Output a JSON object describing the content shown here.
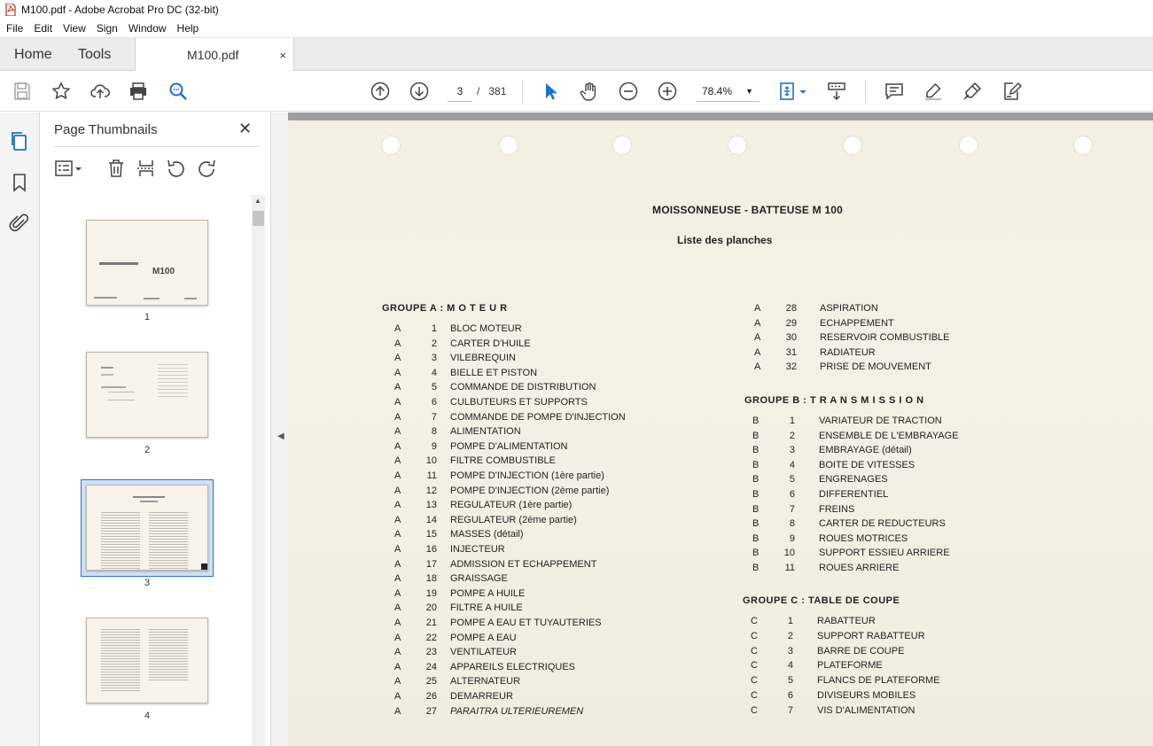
{
  "window": {
    "title": "M100.pdf - Adobe Acrobat Pro DC (32-bit)"
  },
  "menu": [
    "File",
    "Edit",
    "View",
    "Sign",
    "Window",
    "Help"
  ],
  "tabs": {
    "home": "Home",
    "tools": "Tools",
    "document": "M100.pdf",
    "close": "×"
  },
  "toolbar": {
    "page_current": "3",
    "page_separator": "/",
    "page_total": "381",
    "zoom": "78.4%"
  },
  "thumbnails": {
    "title": "Page Thumbnails",
    "pages": [
      {
        "label": "1",
        "text": "M100"
      },
      {
        "label": "2"
      },
      {
        "label": "3",
        "selected": true
      },
      {
        "label": "4"
      }
    ]
  },
  "document": {
    "title": "MOISSONNEUSE - BATTEUSE  M 100",
    "subtitle": "Liste des planches",
    "groups": {
      "a": "GROUPE  A  :  M O T E U R",
      "b": "GROUPE  B  :  T R A N S M I S S I O N",
      "c": "GROUPE  C  :  TABLE  DE  COUPE"
    },
    "col1": [
      [
        "A",
        "1",
        "BLOC MOTEUR"
      ],
      [
        "A",
        "2",
        "CARTER D'HUILE"
      ],
      [
        "A",
        "3",
        "VILEBREQUIN"
      ],
      [
        "A",
        "4",
        "BIELLE ET PISTON"
      ],
      [
        "A",
        "5",
        "COMMANDE DE DISTRIBUTION"
      ],
      [
        "A",
        "6",
        "CULBUTEURS ET SUPPORTS"
      ],
      [
        "A",
        "7",
        "COMMANDE DE POMPE D'INJECTION"
      ],
      [
        "A",
        "8",
        "ALIMENTATION"
      ],
      [
        "A",
        "9",
        "POMPE D'ALIMENTATION"
      ],
      [
        "A",
        "10",
        "FILTRE COMBUSTIBLE"
      ],
      [
        "A",
        "11",
        "POMPE D'INJECTION (1ère partie)"
      ],
      [
        "A",
        "12",
        "POMPE D'INJECTION (2ème partie)"
      ],
      [
        "A",
        "13",
        "REGULATEUR (1ère partie)"
      ],
      [
        "A",
        "14",
        "REGULATEUR (2ème partie)"
      ],
      [
        "A",
        "15",
        "MASSES (détail)"
      ],
      [
        "A",
        "16",
        "INJECTEUR"
      ],
      [
        "A",
        "17",
        "ADMISSION ET ECHAPPEMENT"
      ],
      [
        "A",
        "18",
        "GRAISSAGE"
      ],
      [
        "A",
        "19",
        "POMPE A HUILE"
      ],
      [
        "A",
        "20",
        "FILTRE A HUILE"
      ],
      [
        "A",
        "21",
        "POMPE A EAU ET TUYAUTERIES"
      ],
      [
        "A",
        "22",
        "POMPE A EAU"
      ],
      [
        "A",
        "23",
        "VENTILATEUR"
      ],
      [
        "A",
        "24",
        "APPAREILS ELECTRIQUES"
      ],
      [
        "A",
        "25",
        "ALTERNATEUR"
      ],
      [
        "A",
        "26",
        "DEMARREUR"
      ],
      [
        "A",
        "27",
        "PARAITRA ULTERIEUREMEN"
      ]
    ],
    "col2a": [
      [
        "A",
        "28",
        "ASPIRATION"
      ],
      [
        "A",
        "29",
        "ECHAPPEMENT"
      ],
      [
        "A",
        "30",
        "RESERVOIR COMBUSTIBLE"
      ],
      [
        "A",
        "31",
        "RADIATEUR"
      ],
      [
        "A",
        "32",
        "PRISE DE MOUVEMENT"
      ]
    ],
    "col2b": [
      [
        "B",
        "1",
        "VARIATEUR DE TRACTION"
      ],
      [
        "B",
        "2",
        "ENSEMBLE DE L'EMBRAYAGE"
      ],
      [
        "B",
        "3",
        "EMBRAYAGE (détail)"
      ],
      [
        "B",
        "4",
        "BOITE DE VITESSES"
      ],
      [
        "B",
        "5",
        "ENGRENAGES"
      ],
      [
        "B",
        "6",
        "DIFFERENTIEL"
      ],
      [
        "B",
        "7",
        "FREINS"
      ],
      [
        "B",
        "8",
        "CARTER DE REDUCTEURS"
      ],
      [
        "B",
        "9",
        "ROUES MOTRICES"
      ],
      [
        "B",
        "10",
        "SUPPORT ESSIEU ARRIERE"
      ],
      [
        "B",
        "11",
        "ROUES ARRIERE"
      ]
    ],
    "col2c": [
      [
        "C",
        "1",
        "RABATTEUR"
      ],
      [
        "C",
        "2",
        "SUPPORT RABATTEUR"
      ],
      [
        "C",
        "3",
        "BARRE DE COUPE"
      ],
      [
        "C",
        "4",
        "PLATEFORME"
      ],
      [
        "C",
        "5",
        "FLANCS DE PLATEFORME"
      ],
      [
        "C",
        "6",
        "DIVISEURS MOBILES"
      ],
      [
        "C",
        "7",
        "VIS D'ALIMENTATION"
      ]
    ]
  },
  "colors": {
    "accent": "#1a73c9",
    "selection": "#cfe0f5",
    "paper": "#f4efe3",
    "canvas": "#9e9e9e"
  }
}
